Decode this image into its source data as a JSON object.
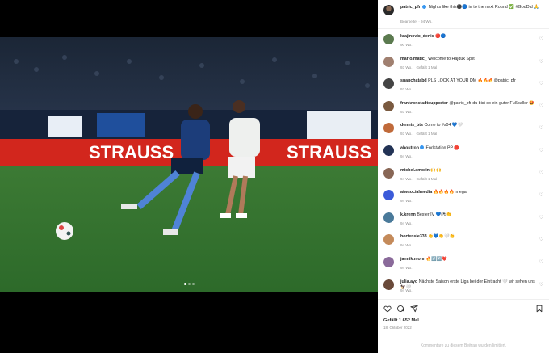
{
  "post": {
    "author": "patric_pfr",
    "caption": "Nights like this⚫🔵 in to the next Round ✅ #GodDid 🙏",
    "edited_label": "Bearbeitet",
    "time": "94 Wo.",
    "likes": "Gefällt 1.652 Mal",
    "date": "18. Oktober 2022",
    "comments_off": "Kommentare zu diesem Beitrag wurden limitiert.",
    "photo_banner": "STRAUSS"
  },
  "labels": {
    "liked": "Gefällt 1 Mal"
  },
  "comments": [
    {
      "user": "krajinovic_denis",
      "verified": false,
      "text": "🔴🔵",
      "time": "90 Wo.",
      "likes": "",
      "avatar_color": "#5b7a4f"
    },
    {
      "user": "mario.matic_",
      "verified": false,
      "text": "Welcome to Hajduk Split",
      "time": "93 Wo.",
      "likes": "Gefällt 1 Mal",
      "avatar_color": "#a08070"
    },
    {
      "user": "snapchatabd",
      "verified": false,
      "text": "PLS LOOK AT YOUR DM 🔥🔥🔥@patric_pfr",
      "time": "93 Wo.",
      "likes": "",
      "avatar_color": "#444444"
    },
    {
      "user": "frankronstadtsupporter",
      "verified": false,
      "text": "@patric_pfr du bist so ein guter Fußballer 🤩",
      "time": "93 Wo.",
      "likes": "",
      "avatar_color": "#7a5a40"
    },
    {
      "user": "dennis_bts",
      "verified": false,
      "text": "Come to #s04 💙🤍",
      "time": "93 Wo.",
      "likes": "Gefällt 1 Mal",
      "avatar_color": "#c06a3a"
    },
    {
      "user": "aboutron",
      "verified": true,
      "text": "Endstation PP 🛑",
      "time": "94 Wo.",
      "likes": "",
      "avatar_color": "#223355"
    },
    {
      "user": "michel.amorin",
      "verified": false,
      "text": "🙌🙌",
      "time": "94 Wo.",
      "likes": "Gefällt 1 Mal",
      "avatar_color": "#886655"
    },
    {
      "user": "atwsocialmedia",
      "verified": false,
      "text": "🔥🔥🔥🔥 mega",
      "time": "94 Wo.",
      "likes": "",
      "avatar_color": "#3b5bd9"
    },
    {
      "user": "k.krenn",
      "verified": false,
      "text": "Bester IV 💙⚽️👏",
      "time": "94 Wo.",
      "likes": "",
      "avatar_color": "#4a7a9a"
    },
    {
      "user": "hortensie333",
      "verified": false,
      "text": "👏💙👏🤍👏",
      "time": "94 Wo.",
      "likes": "",
      "avatar_color": "#c48a5a"
    },
    {
      "user": "jannik.mohr",
      "verified": false,
      "text": "🔥↗️↗️❤️",
      "time": "94 Wo.",
      "likes": "",
      "avatar_color": "#8a6a9a"
    },
    {
      "user": "julia.ayd",
      "verified": false,
      "text": "Nächste Saison erste Liga bei der Eintracht 🤍 wir sehen uns 🦅🤍",
      "time": "94 Wo.",
      "likes": "",
      "avatar_color": "#6a4a3a"
    }
  ],
  "icons": {
    "like": "heart-icon",
    "comment": "comment-icon",
    "share": "share-icon",
    "save": "bookmark-icon"
  },
  "ui": {
    "reply_label": ""
  }
}
